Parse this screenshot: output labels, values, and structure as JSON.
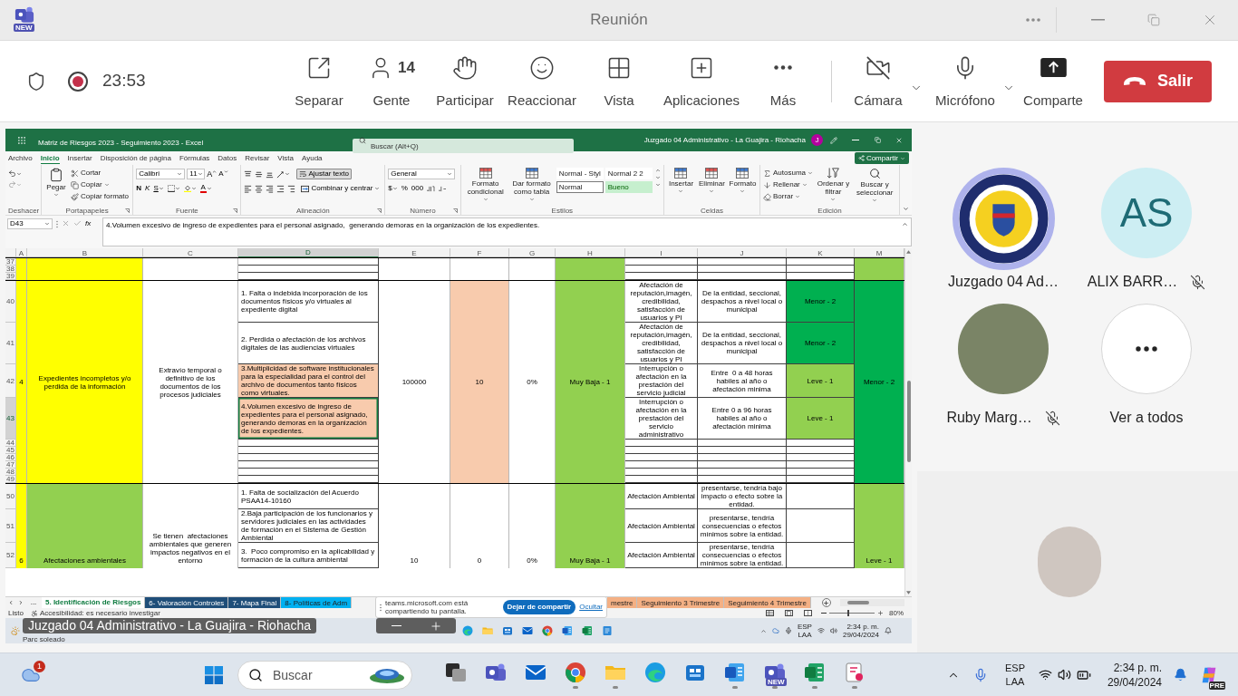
{
  "title_bar": {
    "app_badge": "NEW",
    "title": "Reunión"
  },
  "meeting_bar": {
    "recording": true,
    "timer": "23:53",
    "actions": [
      {
        "kind": "popout",
        "label": "Separar"
      },
      {
        "kind": "people",
        "label": "Gente",
        "count": "14"
      },
      {
        "kind": "raise-hand",
        "label": "Participar"
      },
      {
        "kind": "react",
        "label": "Reaccionar"
      },
      {
        "kind": "view",
        "label": "Vista"
      },
      {
        "kind": "apps",
        "label": "Aplicaciones"
      },
      {
        "kind": "more",
        "label": "Más"
      }
    ],
    "devices": [
      {
        "kind": "camera",
        "label": "Cámara",
        "on": false
      },
      {
        "kind": "mic",
        "label": "Micrófono",
        "on": true
      }
    ],
    "share": "Comparte",
    "leave": "Salir"
  },
  "excel": {
    "title": "Matriz de Riesgos 2023 - Seguimiento 2023 - Excel",
    "search": {
      "placeholder": "Buscar (Alt+Q)"
    },
    "account": "Juzgado 04 Administrativo - La Guajira - Riohacha",
    "account_initial": "J",
    "menu": [
      {
        "label": "Archivo",
        "selected": false
      },
      {
        "label": "Inicio",
        "selected": true
      },
      {
        "label": "Insertar",
        "selected": false
      },
      {
        "label": "Disposición de página",
        "selected": false
      },
      {
        "label": "Fórmulas",
        "selected": false
      },
      {
        "label": "Datos",
        "selected": false
      },
      {
        "label": "Revisar",
        "selected": false
      },
      {
        "label": "Vista",
        "selected": false
      },
      {
        "label": "Ayuda",
        "selected": false
      }
    ],
    "share_button": "Compartir",
    "ribbon": [
      {
        "kind": "undo",
        "label": "Deshacer"
      },
      {
        "kind": "clipboard",
        "label": "Portapapeles",
        "paste": "Pegar",
        "cut": "Cortar",
        "copy": "Copiar",
        "painter": "Copiar formato"
      },
      {
        "kind": "font",
        "label": "Fuente",
        "font": "Calibri",
        "size": "11",
        "grow": "A",
        "shrink": "A",
        "bold": "N",
        "italic": "K",
        "underline": "S",
        "color_letter": "A"
      },
      {
        "kind": "alignment",
        "label": "Alineación",
        "wrap": {
          "label": "Ajustar texto",
          "on": true
        },
        "merge": "Combinar y centrar"
      },
      {
        "kind": "number",
        "label": "Número",
        "format": "General",
        "currency": "$",
        "percent": "%",
        "thousands": "000"
      },
      {
        "kind": "styles",
        "label": "Estilos",
        "conditional": "Formato condicional",
        "table": "Dar formato como tabla",
        "gallery": [
          {
            "label": "Normal - Styl",
            "kind": "plain",
            "selected": false
          },
          {
            "label": "Normal 2 2",
            "kind": "plain",
            "selected": false
          },
          {
            "label": "Normal",
            "kind": "plain",
            "selected": true
          },
          {
            "label": "Bueno",
            "kind": "good",
            "selected": false
          }
        ]
      },
      {
        "kind": "cells",
        "label": "Celdas",
        "buttons": [
          "Insertar",
          "Eliminar",
          "Formato"
        ]
      },
      {
        "kind": "editing",
        "label": "Edición",
        "autosum": "Autosuma",
        "fill": "Rellenar",
        "clear": "Borrar",
        "sort": "Ordenar y filtrar",
        "find": "Buscar y seleccionar"
      }
    ],
    "name_box": "D43",
    "function_label": "fx",
    "formula": "4.Volumen excesivo de ingreso de expedientes para el personal asignado,  generando demoras en la organización de los expedientes.",
    "columns": [
      {
        "label": "A",
        "selected": false
      },
      {
        "label": "B",
        "selected": false
      },
      {
        "label": "C",
        "selected": false
      },
      {
        "label": "D",
        "selected": true
      },
      {
        "label": "E",
        "selected": false
      },
      {
        "label": "F",
        "selected": false
      },
      {
        "label": "G",
        "selected": false
      },
      {
        "label": "H",
        "selected": false
      },
      {
        "label": "I",
        "selected": false
      },
      {
        "label": "J",
        "selected": false
      },
      {
        "label": "K",
        "selected": false
      },
      {
        "label": "M",
        "selected": false
      }
    ],
    "blocks": [
      {
        "rows": [
          "37",
          "38",
          "39"
        ],
        "col_b": {
          "color": "#ffff00"
        },
        "col_m": {
          "color": "#92d050"
        }
      },
      {
        "rows": [
          "40",
          "41",
          "42",
          "43",
          "44",
          "45",
          "46",
          "47",
          "48",
          "49"
        ],
        "col_a": "4",
        "col_b": {
          "text": "Expedientes incompletos y/o perdida de la información",
          "color": "#ffff00"
        },
        "col_c": "Extravío temporal o definitivo de los  documentos de los procesos judiciales",
        "col_d": [
          {
            "text": "1. Falta o indebida incorporación de los documentos físicos y/o virtuales al expediente digital",
            "highlight": false,
            "selected": false
          },
          {
            "text": "2. Perdida o afectación de los archivos digitales de las audiencias virtuales",
            "highlight": false,
            "selected": false
          },
          {
            "text": "3.Multiplicidad de software institucionales para la especialidad para el control del archivo de documentos tanto físicos como virtuales.",
            "highlight": true,
            "selected": false
          },
          {
            "text": "4.Volumen excesivo de ingreso de expedientes para el personal asignado,  generando demoras en la organización de los expedientes.",
            "highlight": true,
            "selected": true
          }
        ],
        "col_e": "100000",
        "col_f": {
          "text": "10",
          "highlight": true
        },
        "col_g": "0%",
        "col_h": "Muy Baja - 1",
        "cells_i_j_k": [
          {
            "col_i": "Afectación de reputación,imagén, credibilidad, satisfacción de usuarios y PI",
            "col_j": "De la entidad, seccional, despachos a nivel local o municipal",
            "col_k": {
              "text": "Menor - 2",
              "color": "#00b050"
            }
          },
          {
            "col_i": "Afectación de reputación,imagén, credibilidad, satisfacción de usuarios y PI",
            "col_j": "De la entidad, seccional, despachos a nivel local o municipal",
            "col_k": {
              "text": "Menor - 2",
              "color": "#00b050"
            }
          },
          {
            "col_i": "Interrupción o afectación en la prestación del servicio judicial",
            "col_j": "Entre  0 a 48 horas habiles al año o afectación minima",
            "col_k": {
              "text": "Leve - 1",
              "color": "#92d050"
            }
          },
          {
            "col_i": "Interrupción o afectación en la prestación del servicio administrativo",
            "col_j": "Entre 0 a 96 horas habiles al año o afectación minima",
            "col_k": {
              "text": "Leve - 1",
              "color": "#92d050"
            }
          }
        ],
        "col_m": {
          "text": "Menor - 2",
          "color": "#00b050"
        }
      },
      {
        "rows": [
          "50",
          "51",
          "52"
        ],
        "col_a": "6",
        "col_b": {
          "text": "Afectaciones ambientales",
          "color": "#92d050"
        },
        "col_c": "Se tienen  afectaciones ambientales que generen impactos negativos en el entorno",
        "col_d": [
          {
            "text": "1. Falta de socialización del Acuerdo PSAA14-10160",
            "highlight": false,
            "selected": false
          },
          {
            "text": "2.Baja participación de los funcionarios y servidores judiciales en las actividades de formación en el Sistema de Gestión Ambiental",
            "highlight": false,
            "selected": false
          },
          {
            "text": "3.  Poco compromiso en la aplicabilidad y formación de la cultura ambiental",
            "highlight": false,
            "selected": false
          }
        ],
        "col_e": "10",
        "col_f": {
          "text": "0",
          "highlight": false
        },
        "col_g": "0%",
        "col_h": "Muy Baja - 1",
        "cells_i_j_k": [
          {
            "col_i": "Afectación Ambiental",
            "col_j": "presentarse, tendría bajo impacto o efecto sobre la entidad."
          },
          {
            "col_i": "Afectación Ambiental",
            "col_j": "presentarse, tendría consecuencias o efectos mínimos sobre la entidad."
          },
          {
            "col_i": "Afectación Ambiental",
            "col_j": "presentarse, tendría consecuencias o efectos mínimos sobre la entidad."
          }
        ],
        "col_m": {
          "text": "Leve - 1",
          "color": "#92d050"
        }
      }
    ],
    "more_sheets": "...",
    "sheet_tabs": [
      {
        "label": "5. Identificación de Riesgos",
        "selected": true
      },
      {
        "label": "6- Valoración Controles",
        "selected": false,
        "color": "#1f4e79"
      },
      {
        "label": "7- Mapa Final",
        "selected": false,
        "color": "#1f4e79"
      },
      {
        "label": "8- Políticas de Adm",
        "selected": false,
        "color": "#00b0f0"
      }
    ],
    "sheet_tabs_after": [
      {
        "label": "mestre",
        "selected": false,
        "color": "#f4b084"
      },
      {
        "label": "Seguimiento 3 Trimestre",
        "selected": false,
        "color": "#f4b084"
      },
      {
        "label": "Seguimiento 4 Trimestre",
        "selected": false,
        "color": "#f4b084"
      }
    ],
    "status": "Listo",
    "accessibility": "Accesibilidad: es necesario investigar",
    "zoom_slider": {
      "level": 0.4
    },
    "zoom": "80%"
  },
  "share_notice": {
    "message": "teams.microsoft.com está compartiendo tu pantalla.",
    "stop": "Dejar de compartir",
    "hide": "Ocultar"
  },
  "presenter_label": "Juzgado 04 Administrativo - La Guajira - Riohacha",
  "inner_taskbar": {
    "weather": "Parc soleado",
    "apps": [
      {
        "kind": "edge"
      },
      {
        "kind": "files"
      },
      {
        "kind": "store"
      },
      {
        "kind": "mail"
      },
      {
        "kind": "chrome"
      },
      {
        "kind": "word"
      },
      {
        "kind": "excel"
      },
      {
        "kind": "notepad"
      }
    ],
    "language": [
      "ESP",
      "LAA"
    ],
    "time": "2:34 p. m.",
    "date": "29/04/2024"
  },
  "participants": [
    {
      "kind": "logo",
      "name": "Juzgado 04 Ad…",
      "speaking": true,
      "muted": false
    },
    {
      "kind": "initials",
      "initials": "AS",
      "name": "ALIX BARR…",
      "speaking": false,
      "muted": true
    },
    {
      "kind": "photo",
      "name": "Ruby Marg…",
      "speaking": false,
      "muted": true
    }
  ],
  "see_all": "Ver a todos",
  "taskbar": {
    "weather_badge": "1",
    "search": {
      "placeholder": "Buscar"
    },
    "apps": [
      {
        "kind": "task-view",
        "running": false
      },
      {
        "kind": "teams",
        "running": false
      },
      {
        "kind": "mail",
        "running": false
      },
      {
        "kind": "chrome",
        "running": true
      },
      {
        "kind": "files",
        "running": true
      },
      {
        "kind": "edge",
        "running": false
      },
      {
        "kind": "store",
        "running": false
      },
      {
        "kind": "word",
        "running": true
      },
      {
        "kind": "teams",
        "badge": "NEW",
        "running": true
      },
      {
        "kind": "excel",
        "running": true
      },
      {
        "kind": "snip",
        "running": true
      }
    ],
    "language": [
      "ESP",
      "LAA"
    ],
    "time": "2:34 p. m.",
    "date": "29/04/2024",
    "copilot_badge": "PRE"
  }
}
